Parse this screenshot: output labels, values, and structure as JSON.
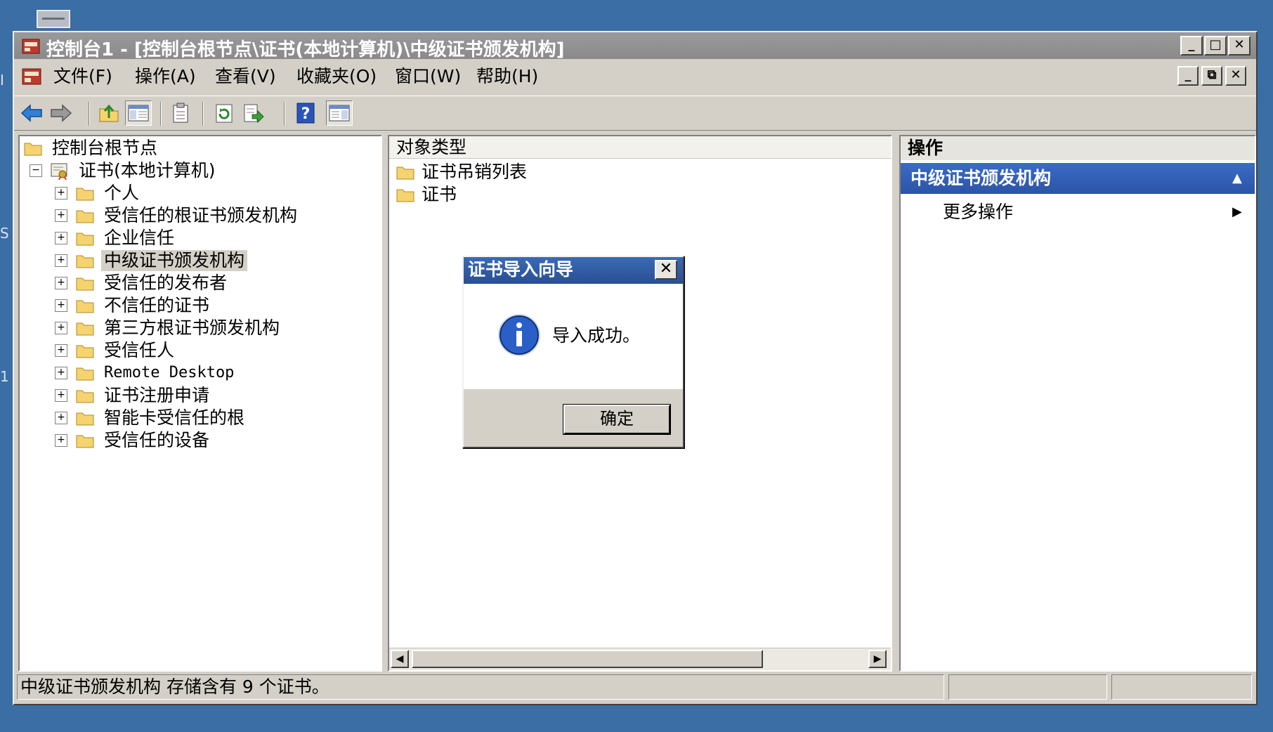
{
  "window": {
    "title": "控制台1 - [控制台根节点\\证书(本地计算机)\\中级证书颁发机构]",
    "controls": {
      "minimize": "_",
      "maximize": "□",
      "close": "✕"
    },
    "mdi_controls": {
      "minimize": "_",
      "restore": "⧉",
      "close": "✕"
    }
  },
  "menu": [
    "文件(F)",
    "操作(A)",
    "查看(V)",
    "收藏夹(O)",
    "窗口(W)",
    "帮助(H)"
  ],
  "toolbar_icons": [
    "back-arrow-icon",
    "forward-arrow-icon",
    "up-folder-icon",
    "show-hide-tree-icon",
    "properties-icon",
    "refresh-icon",
    "export-list-icon",
    "help-icon",
    "show-action-pane-icon"
  ],
  "tree": {
    "root": "控制台根节点",
    "store": "证书(本地计算机)",
    "collapse_symbol": "−",
    "expand_symbol": "+",
    "items": [
      "个人",
      "受信任的根证书颁发机构",
      "企业信任",
      "中级证书颁发机构",
      "受信任的发布者",
      "不信任的证书",
      "第三方根证书颁发机构",
      "受信任人",
      "Remote Desktop",
      "证书注册申请",
      "智能卡受信任的根",
      "受信任的设备"
    ],
    "selected": "中级证书颁发机构"
  },
  "center": {
    "column_header": "对象类型",
    "items": [
      "证书吊销列表",
      "证书"
    ],
    "scroll_left": "◀",
    "scroll_right": "▶"
  },
  "actions": {
    "header": "操作",
    "section": "中级证书颁发机构",
    "section_arrow": "▲",
    "more": "更多操作",
    "more_arrow": "▶"
  },
  "status": {
    "text": "中级证书颁发机构 存储含有 9 个证书。"
  },
  "dialog": {
    "title": "证书导入向导",
    "close": "✕",
    "message": "导入成功。",
    "ok_label": "确定"
  },
  "desktop_edge": [
    "I",
    "S",
    "1"
  ],
  "colors": {
    "desktop": "#3a6ea5",
    "section_blue": "#2b54a8",
    "dialog_title": "#2a4f92"
  }
}
